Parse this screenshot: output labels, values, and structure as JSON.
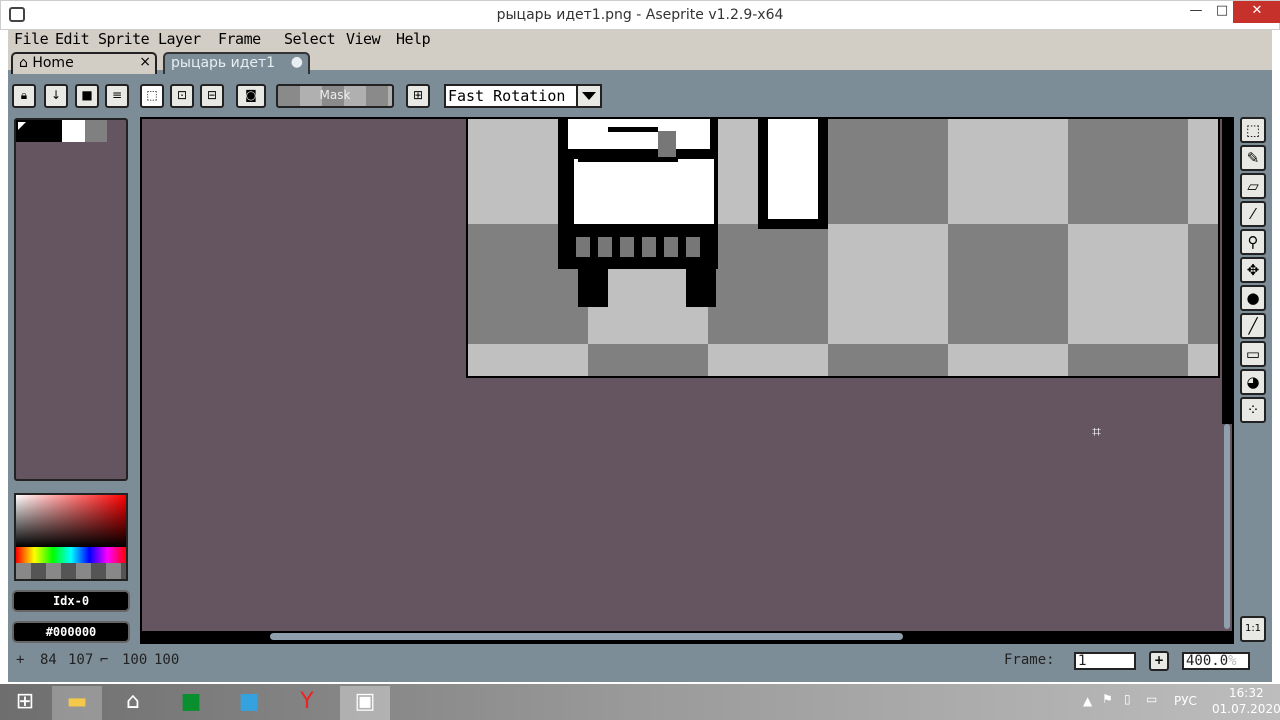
{
  "window": {
    "title": "рыцарь идет1.png - Aseprite v1.2.9-x64",
    "minimize": "—",
    "maximize": "□",
    "close": "✕"
  },
  "menu": [
    "File",
    "Edit",
    "Sprite",
    "Layer",
    "Frame",
    "Select",
    "View",
    "Help"
  ],
  "tabs": [
    {
      "label": "Home",
      "close": "×"
    },
    {
      "label": "рыцарь идет1",
      "modified": "●"
    }
  ],
  "toolbar": {
    "buttons": [
      "lock-icon",
      "arrow-down-icon",
      "square-icon",
      "menu-icon",
      "select-dotted-icon",
      "select-center-icon",
      "select-subtract-icon",
      "mask-preview-icon"
    ],
    "mask_label": "Mask",
    "pivot": "pivot-icon",
    "rotation_algorithm": "Fast Rotation"
  },
  "colorbar": {
    "index_label": "Idx-0",
    "hex_label": "#000000",
    "palette": [
      "#000000",
      "#000000",
      "#ffffff",
      "#808080"
    ]
  },
  "tools": [
    "rectangular-marquee-icon",
    "pencil-icon",
    "eraser-icon",
    "eyedropper-icon",
    "zoom-icon",
    "move-icon",
    "paint-bucket-icon",
    "line-icon",
    "rectangle-icon",
    "contour-icon",
    "spray-icon"
  ],
  "status": {
    "cursor_x": "84",
    "cursor_y": "107",
    "size_w": "100",
    "size_h": "100",
    "frame_label": "Frame:",
    "frame_value": "1",
    "add_frame": "+",
    "zoom": "400.0",
    "zoom_unit": "%",
    "one_to_one": "1:1"
  },
  "taskbar": {
    "lang": "РУС",
    "time": "16:32",
    "date": "01.07.2020"
  }
}
